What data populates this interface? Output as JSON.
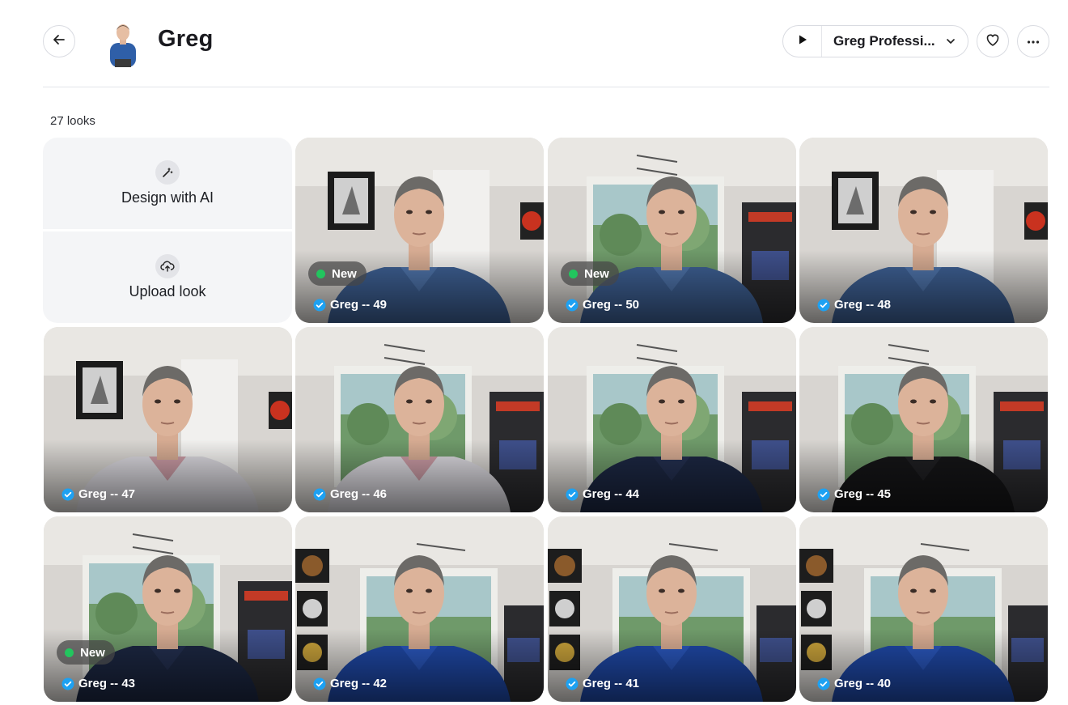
{
  "header": {
    "title": "Greg",
    "voice_label": "Greg Professi...",
    "back_icon": "arrow-left-icon",
    "heart_icon": "heart-icon",
    "more_icon": "more-horizontal-icon"
  },
  "looks_count": "27 looks",
  "actions": {
    "design": "Design with AI",
    "upload": "Upload look"
  },
  "new_label": "New",
  "colors": {
    "new_dot": "#22c55e",
    "verified": "#1da1f2"
  },
  "looks": [
    {
      "label": "Greg -- 49",
      "is_new": true,
      "scene": "frame",
      "shirt": "blue-stripe"
    },
    {
      "label": "Greg -- 50",
      "is_new": true,
      "scene": "window",
      "shirt": "blue-stripe"
    },
    {
      "label": "Greg -- 48",
      "is_new": false,
      "scene": "frame",
      "shirt": "blue-stripe"
    },
    {
      "label": "Greg -- 47",
      "is_new": false,
      "scene": "frame",
      "shirt": "check"
    },
    {
      "label": "Greg -- 46",
      "is_new": false,
      "scene": "window",
      "shirt": "check"
    },
    {
      "label": "Greg -- 44",
      "is_new": false,
      "scene": "window",
      "shirt": "navy-polo"
    },
    {
      "label": "Greg -- 45",
      "is_new": false,
      "scene": "window",
      "shirt": "black-polo"
    },
    {
      "label": "Greg -- 43",
      "is_new": true,
      "scene": "window",
      "shirt": "navy-polo"
    },
    {
      "label": "Greg -- 42",
      "is_new": false,
      "scene": "posters",
      "shirt": "royal-polo"
    },
    {
      "label": "Greg -- 41",
      "is_new": false,
      "scene": "posters",
      "shirt": "royal-polo"
    },
    {
      "label": "Greg -- 40",
      "is_new": false,
      "scene": "posters",
      "shirt": "royal-polo"
    }
  ]
}
